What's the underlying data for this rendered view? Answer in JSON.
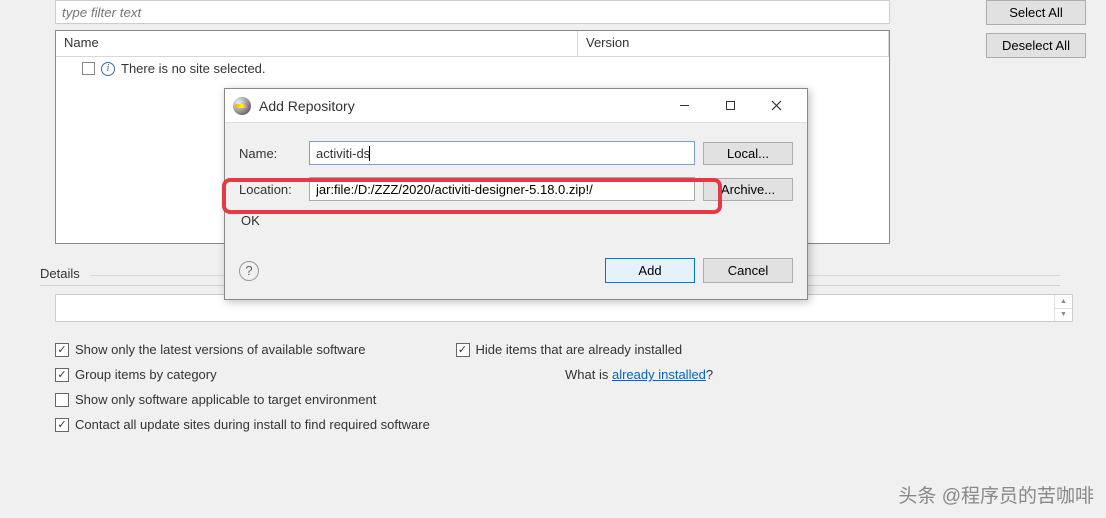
{
  "filter": {
    "placeholder": "type filter text"
  },
  "table": {
    "columns": {
      "name": "Name",
      "version": "Version"
    },
    "empty_msg": "There is no site selected."
  },
  "side": {
    "select_all": "Select All",
    "deselect_all": "Deselect All"
  },
  "details": {
    "label": "Details"
  },
  "options": {
    "show_latest": "Show only the latest versions of available software",
    "hide_installed": "Hide items that are already installed",
    "group_category": "Group items by category",
    "what_is_prefix": "What is ",
    "what_is_link": "already installed",
    "what_is_suffix": "?",
    "show_target_env": "Show only software applicable to target environment",
    "contact_sites": "Contact all update sites during install to find required software"
  },
  "dialog": {
    "title": "Add Repository",
    "name_label": "Name:",
    "name_value": "activiti-ds",
    "local_btn": "Local...",
    "location_label": "Location:",
    "location_value": "jar:file:/D:/ZZZ/2020/activiti-designer-5.18.0.zip!/",
    "archive_btn": "Archive...",
    "ok": "OK",
    "add": "Add",
    "cancel": "Cancel"
  },
  "watermark": "头条 @程序员的苦咖啡"
}
